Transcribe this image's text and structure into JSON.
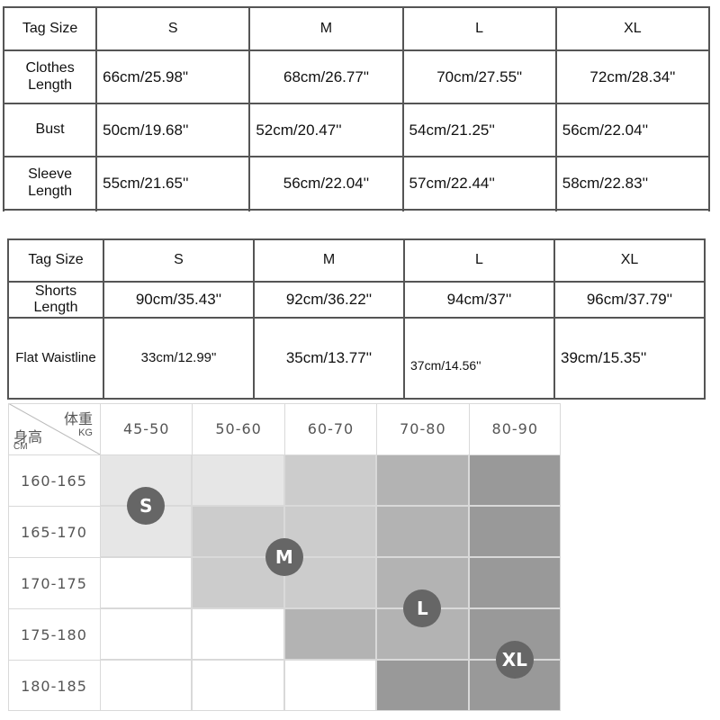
{
  "top_table": {
    "header": [
      "Tag Size",
      "S",
      "M",
      "L",
      "XL"
    ],
    "rows": [
      {
        "label": [
          "Clothes",
          "Length"
        ],
        "values": [
          "66cm/25.98\"",
          "68cm/26.77\"",
          "70cm/27.55\"",
          "72cm/28.34\""
        ]
      },
      {
        "label": [
          "Bust"
        ],
        "values": [
          "50cm/19.68''",
          "52cm/20.47''",
          "54cm/21.25''",
          "56cm/22.04''"
        ]
      },
      {
        "label": [
          "Sleeve",
          "Length"
        ],
        "values": [
          "55cm/21.65''",
          "56cm/22.04''",
          "57cm/22.44''",
          "58cm/22.83''"
        ]
      }
    ]
  },
  "bottom_table": {
    "header": [
      "Tag Size",
      "S",
      "M",
      "L",
      "XL"
    ],
    "rows": [
      {
        "label": [
          "Shorts",
          "Length"
        ],
        "values": [
          "90cm/35.43''",
          "92cm/36.22''",
          "94cm/37''",
          "96cm/37.79''"
        ]
      },
      {
        "label": [
          "Flat Waistline"
        ],
        "values": [
          "33cm/12.99\"",
          "35cm/13.77''",
          "37cm/14.56''",
          "39cm/15.35''"
        ]
      }
    ]
  },
  "size_chart": {
    "corner": {
      "weight_label": "体重",
      "weight_unit": "KG",
      "height_label": "身高",
      "height_unit": "CM"
    },
    "weight_ranges": [
      "45-50",
      "50-60",
      "60-70",
      "70-80",
      "80-90"
    ],
    "height_ranges": [
      "160-165",
      "165-170",
      "170-175",
      "175-180",
      "180-185"
    ],
    "cell_shades": [
      [
        "#e6e6e6",
        "#e6e6e6",
        "#cccccc",
        "#b3b3b3",
        "#999999"
      ],
      [
        "#e6e6e6",
        "#cccccc",
        "#cccccc",
        "#b3b3b3",
        "#999999"
      ],
      [
        "#ffffff",
        "#cccccc",
        "#cccccc",
        "#b3b3b3",
        "#999999"
      ],
      [
        "#ffffff",
        "#ffffff",
        "#b3b3b3",
        "#b3b3b3",
        "#999999"
      ],
      [
        "#ffffff",
        "#ffffff",
        "#ffffff",
        "#999999",
        "#999999"
      ]
    ],
    "badges": [
      {
        "label": "S",
        "col": 0.5,
        "row": 1.0
      },
      {
        "label": "M",
        "col": 2.0,
        "row": 2.0
      },
      {
        "label": "L",
        "col": 3.5,
        "row": 3.0
      },
      {
        "label": "XL",
        "col": 4.5,
        "row": 4.0
      }
    ],
    "badge_color": "#666666"
  }
}
